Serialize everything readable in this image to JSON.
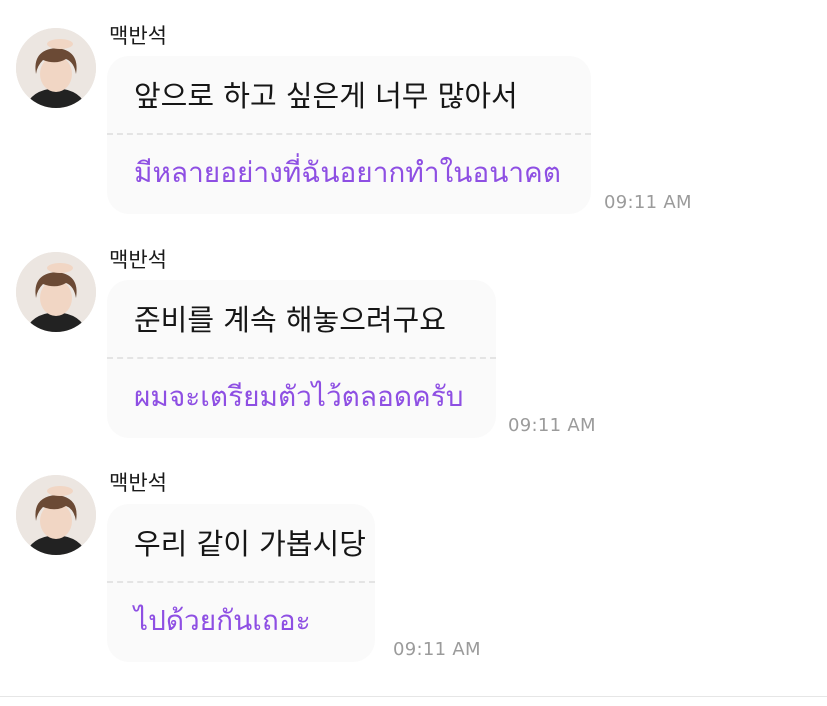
{
  "messages": [
    {
      "sender": "맥반석",
      "avatar_icon": "profile-photo",
      "text_ko": "앞으로 하고 싶은게 너무 많아서",
      "text_th": "มีหลายอย่างที่ฉันอยากทำในอนาคต",
      "time": "09:11 AM"
    },
    {
      "sender": "맥반석",
      "avatar_icon": "profile-photo",
      "text_ko": "준비를 계속 해놓으려구요",
      "text_th": "ผมจะเตรียมตัวไว้ตลอดครับ",
      "time": "09:11 AM"
    },
    {
      "sender": "맥반석",
      "avatar_icon": "profile-photo",
      "text_ko": "우리 같이 가봅시당",
      "text_th": "ไปด้วยกันเถอะ",
      "time": "09:11 AM"
    }
  ],
  "colors": {
    "translation_text": "#8e4fe3",
    "bubble_bg": "#fafafa",
    "timestamp": "#9b9b9b"
  }
}
